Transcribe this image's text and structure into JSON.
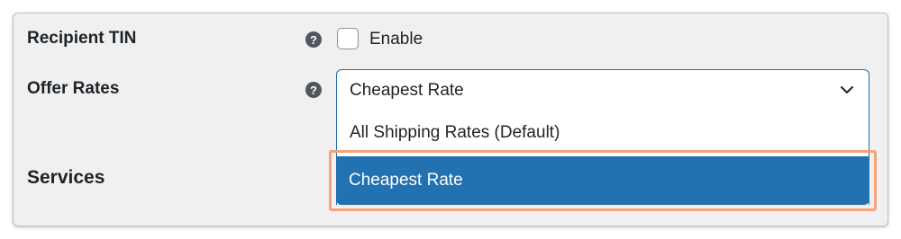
{
  "rows": {
    "recipient_tin": {
      "label": "Recipient TIN",
      "help_icon": "question-circle-icon",
      "help_glyph": "?",
      "checkbox_label": "Enable",
      "checked": false
    },
    "offer_rates": {
      "label": "Offer Rates",
      "help_icon": "question-circle-icon",
      "help_glyph": "?",
      "selected_value": "Cheapest Rate",
      "chevron_icon": "chevron-down-icon",
      "options": [
        {
          "label": "All Shipping Rates (Default)",
          "selected": false
        },
        {
          "label": "Cheapest Rate",
          "selected": true
        }
      ]
    },
    "services": {
      "label": "Services"
    }
  },
  "colors": {
    "accent": "#2271b1",
    "highlight_outline": "#f5a37a",
    "panel_background": "#f0f0f1",
    "help_icon": "#50575e"
  }
}
